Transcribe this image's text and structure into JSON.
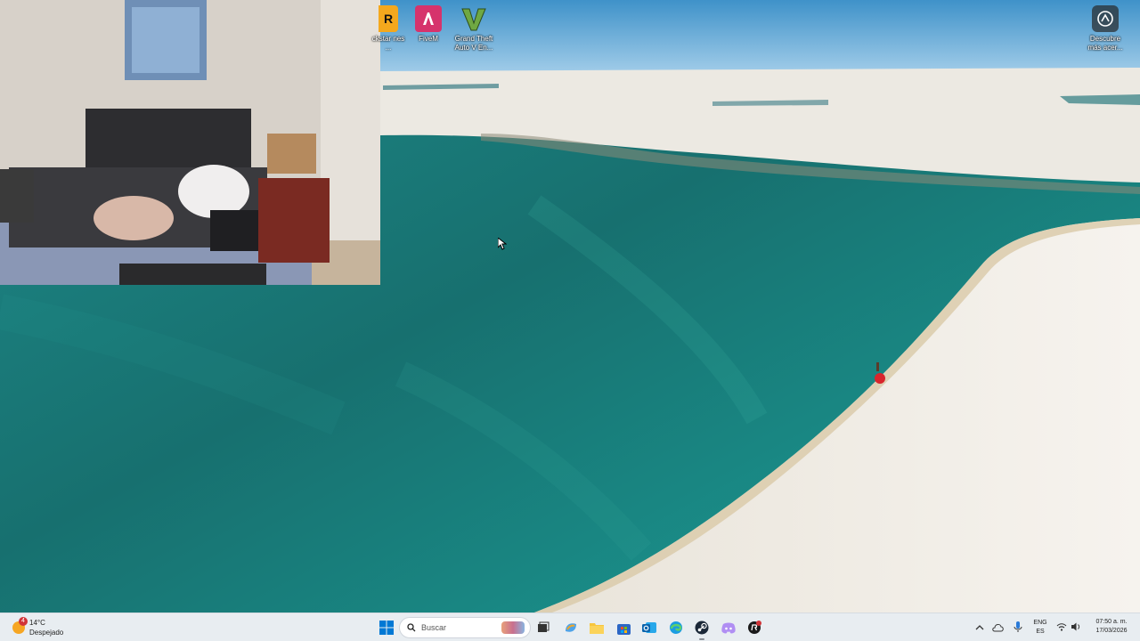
{
  "desktop": {
    "icons": [
      {
        "name": "rockstar-games-launcher",
        "label": "ckstar nes ...",
        "icon": "rockstar-icon",
        "color": "#f4a81d"
      },
      {
        "name": "fivem",
        "label": "FiveM",
        "icon": "fivem-icon",
        "color": "#d6336c"
      },
      {
        "name": "gta-v",
        "label": "Grand Theft Auto V En...",
        "icon": "gta-v-icon",
        "color": "#6fa843"
      }
    ],
    "corner_icon": {
      "label": "Descubre más acer...",
      "icon": "discover-icon"
    }
  },
  "webcam": {
    "label": "webcam-overlay"
  },
  "taskbar": {
    "weather": {
      "temp": "14°C",
      "condition": "Despejado",
      "badge": "4"
    },
    "search_placeholder": "Buscar",
    "apps": [
      {
        "name": "start",
        "icon": "windows-start-icon"
      },
      {
        "name": "search-highlight",
        "icon": "search-highlight-icon"
      },
      {
        "name": "task-view",
        "icon": "task-view-icon"
      },
      {
        "name": "copilot",
        "icon": "copilot-icon"
      },
      {
        "name": "file-explorer",
        "icon": "folder-icon"
      },
      {
        "name": "microsoft-store",
        "icon": "store-icon"
      },
      {
        "name": "outlook",
        "icon": "outlook-icon"
      },
      {
        "name": "edge",
        "icon": "edge-icon"
      },
      {
        "name": "steam",
        "icon": "steam-icon"
      },
      {
        "name": "discord",
        "icon": "discord-icon"
      },
      {
        "name": "rockstar",
        "icon": "rockstar-taskbar-icon"
      }
    ],
    "tray": {
      "language": "ENG",
      "layout": "ES",
      "time": "07:50 a. m.",
      "date": "17/03/2026"
    }
  },
  "colors": {
    "accent": "#0067c0",
    "taskbar_bg": "#eef2f6"
  }
}
